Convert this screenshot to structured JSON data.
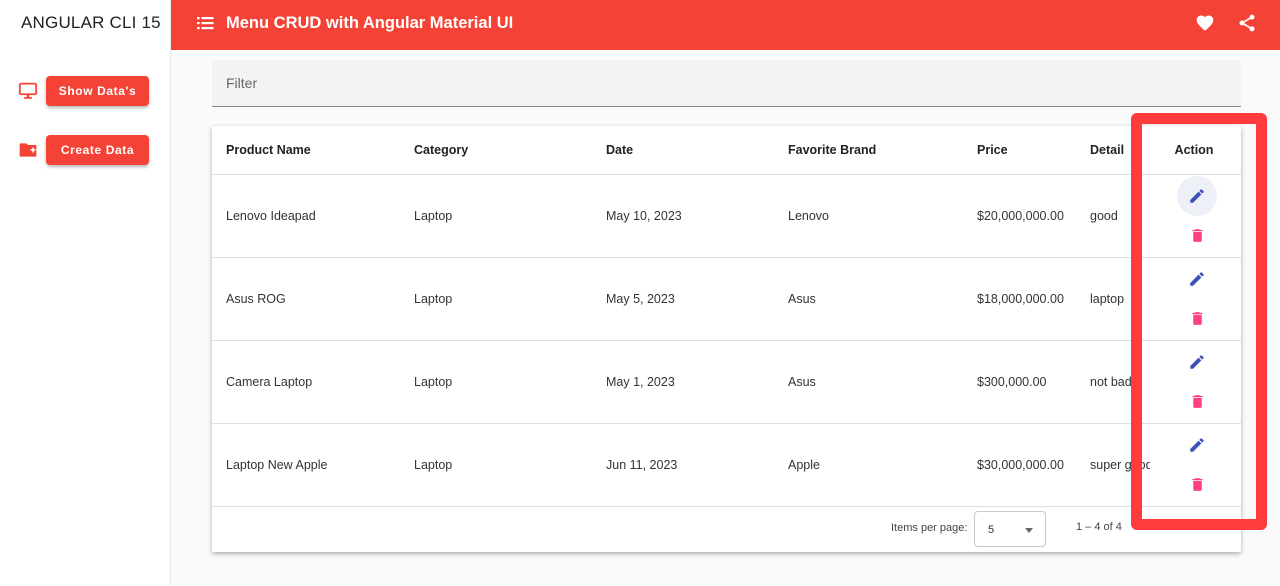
{
  "sidebar": {
    "brand": "ANGULAR CLI 15",
    "show_button": "Show Data's",
    "create_button": "Create Data"
  },
  "toolbar": {
    "title": "Menu CRUD with Angular Material UI",
    "icons": [
      "menu-icon",
      "heart-icon",
      "share-icon"
    ]
  },
  "filter": {
    "placeholder": "Filter"
  },
  "table": {
    "headers": {
      "product": "Product Name",
      "category": "Category",
      "date": "Date",
      "brand": "Favorite Brand",
      "price": "Price",
      "detail": "Detail",
      "action": "Action"
    },
    "rows": [
      {
        "product": "Lenovo Ideapad",
        "category": "Laptop",
        "date": "May 10, 2023",
        "brand": "Lenovo",
        "price": "$20,000,000.00",
        "detail": "good"
      },
      {
        "product": "Asus ROG",
        "category": "Laptop",
        "date": "May 5, 2023",
        "brand": "Asus",
        "price": "$18,000,000.00",
        "detail": "laptop"
      },
      {
        "product": "Camera Laptop",
        "category": "Laptop",
        "date": "May 1, 2023",
        "brand": "Asus",
        "price": "$300,000.00",
        "detail": "not bad"
      },
      {
        "product": "Laptop New Apple",
        "category": "Laptop",
        "date": "Jun 11, 2023",
        "brand": "Apple",
        "price": "$30,000,000.00",
        "detail": "super good"
      }
    ]
  },
  "paginator": {
    "label": "Items per page:",
    "page_size": "5",
    "range": "1 – 4 of 4"
  },
  "colors": {
    "primary": "#f44336",
    "edit_icon": "#3f51b5",
    "delete_icon": "#ff4081",
    "annotation": "#ff3b3b"
  }
}
